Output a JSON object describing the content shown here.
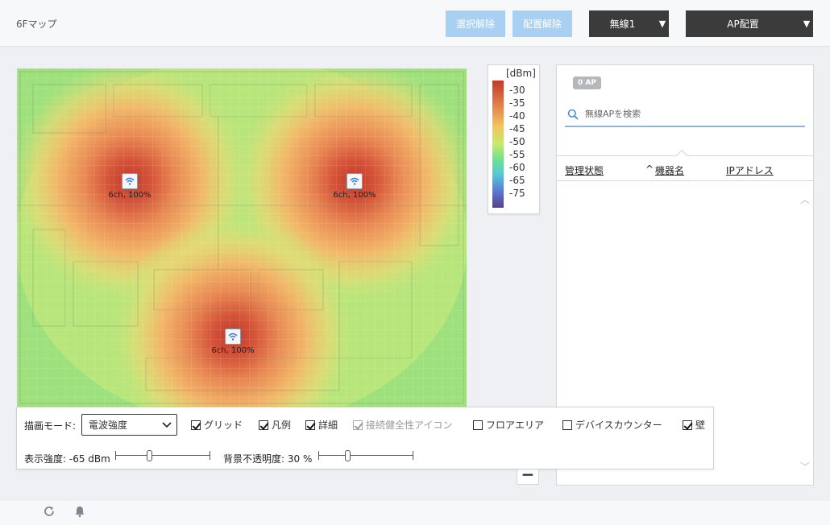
{
  "header": {
    "title": "6Fマップ",
    "deselect_label": "選択解除",
    "unplace_label": "配置解除",
    "radio_select": "無線1",
    "mode_select": "AP配置"
  },
  "map": {
    "access_points": [
      {
        "label": "6ch, 100%"
      },
      {
        "label": "6ch, 100%"
      },
      {
        "label": "6ch, 100%"
      }
    ]
  },
  "legend": {
    "unit": "[dBm]",
    "ticks": [
      "-30",
      "-35",
      "-40",
      "-45",
      "-50",
      "-55",
      "-60",
      "-65",
      "-75"
    ]
  },
  "zoom": {
    "out_label": "−"
  },
  "panel": {
    "ap_count": "0 AP",
    "search_placeholder": "無線APを検索",
    "columns": {
      "status": "管理状態",
      "sort_indicator": "^",
      "device_name": "機器名",
      "ip_address": "IPアドレス"
    }
  },
  "controls": {
    "draw_mode_label": "描画モード:",
    "draw_mode_value": "電波強度",
    "checkboxes": {
      "grid": {
        "label": "グリッド",
        "checked": true
      },
      "legend": {
        "label": "凡例",
        "checked": true
      },
      "detail": {
        "label": "詳細",
        "checked": true
      },
      "health_icon": {
        "label": "接続健全性アイコン",
        "checked": true,
        "disabled": true
      },
      "floor_area": {
        "label": "フロアエリア",
        "checked": false
      },
      "device_counter": {
        "label": "デバイスカウンター",
        "checked": false
      },
      "wall": {
        "label": "壁",
        "checked": true
      }
    },
    "display_strength_label": "表示強度: -65 dBm",
    "display_strength_fraction": 0.35,
    "bg_opacity_label": "背景不透明度: 30 %",
    "bg_opacity_fraction": 0.3
  },
  "colors": {
    "accent_light": "#a7d0f3",
    "dark_button": "#3b3b3b"
  },
  "footer": {
    "icons": [
      "refresh-icon",
      "bell-icon"
    ]
  }
}
